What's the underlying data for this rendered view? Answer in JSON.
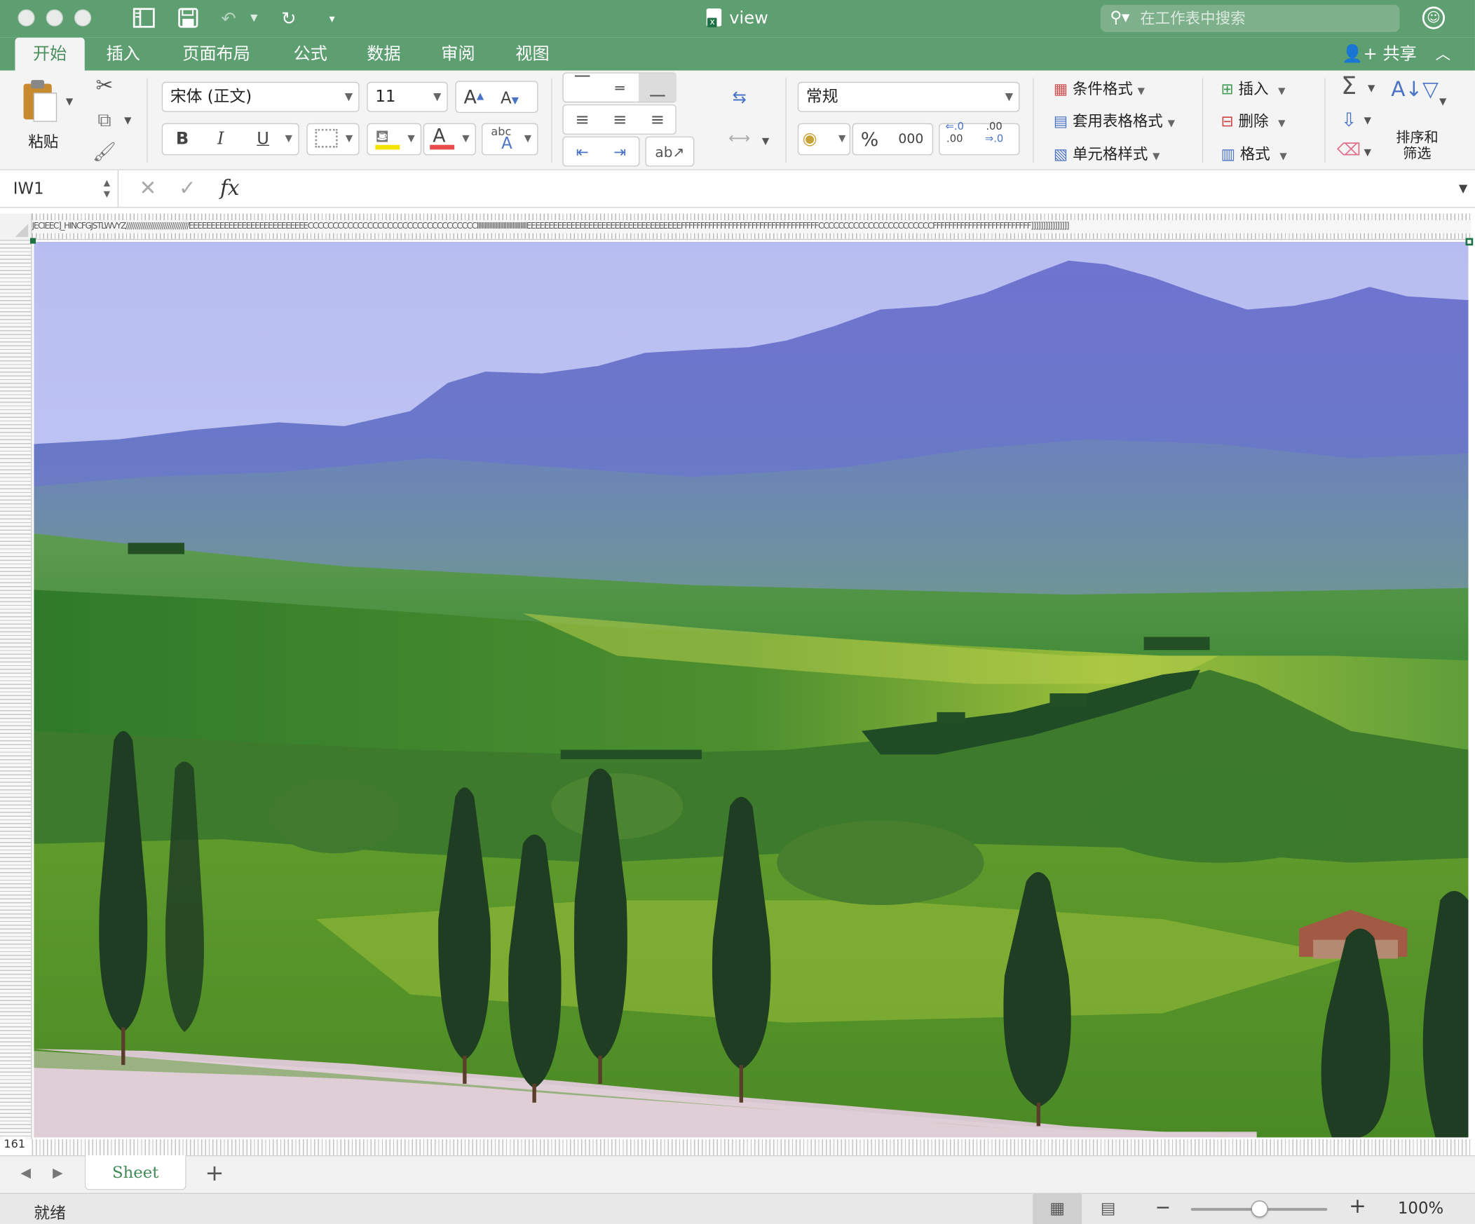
{
  "window": {
    "title": "view",
    "search_placeholder": "在工作表中搜索",
    "share_label": "共享"
  },
  "ribbon_tabs": [
    {
      "label": "开始",
      "active": true
    },
    {
      "label": "插入"
    },
    {
      "label": "页面布局"
    },
    {
      "label": "公式"
    },
    {
      "label": "数据"
    },
    {
      "label": "审阅"
    },
    {
      "label": "视图"
    }
  ],
  "clipboard": {
    "paste_label": "粘贴"
  },
  "font": {
    "name": "宋体 (正文)",
    "size": "11",
    "bold": "B",
    "italic": "I",
    "underline": "U",
    "grow": "A",
    "shrink": "A",
    "font_color_letter": "A",
    "abc_label": "abc",
    "abc_letter": "A",
    "font_color": "#e84a4a",
    "fill_color": "#f5e400"
  },
  "number": {
    "format": "常规",
    "percent": "%",
    "thousands": "000",
    "inc_decimal": ".00",
    "dec_decimal": ".00"
  },
  "styles": {
    "conditional": "条件格式",
    "table_format": "套用表格格式",
    "cell_styles": "单元格样式"
  },
  "cells": {
    "insert": "插入",
    "delete": "删除",
    "format": "格式"
  },
  "editing": {
    "sort_filter_line1": "排序和",
    "sort_filter_line2": "筛选"
  },
  "formula_bar": {
    "name_box": "IW1",
    "fx": "fx"
  },
  "grid": {
    "column_header_text": "JECIEEC]_HINCFGJSTLWVYZ/////////////////////////////////EEEEEEEEEEEEEEEEEEEEEEEEEEECCCCCCCCCCCCCCCCCCCCCCCCCCCCCCCCCCIIIIIIIIIIIIIIIIIIIIIIIIIIIIIIIIEEEEEEEEEEEEEEEEEEEEEEEEEEEEEEEEEEEFFFFFFFFFFFFFFFFFFFFFFFFFFFFFFFFFFFCCCCCCCCCCCCCCCCCCCCCCCFFFFFFFFFFFFFFFFFFFFFFFFF]]]]]]]]]]]]]]]]",
    "last_row": "161"
  },
  "sheet_tabs": {
    "active": "Sheet",
    "add": "+"
  },
  "status_bar": {
    "ready": "就绪",
    "zoom": "100%",
    "zoom_fraction": 0.5
  },
  "colors": {
    "accent": "#5d9f70",
    "selection": "#1e7145"
  }
}
